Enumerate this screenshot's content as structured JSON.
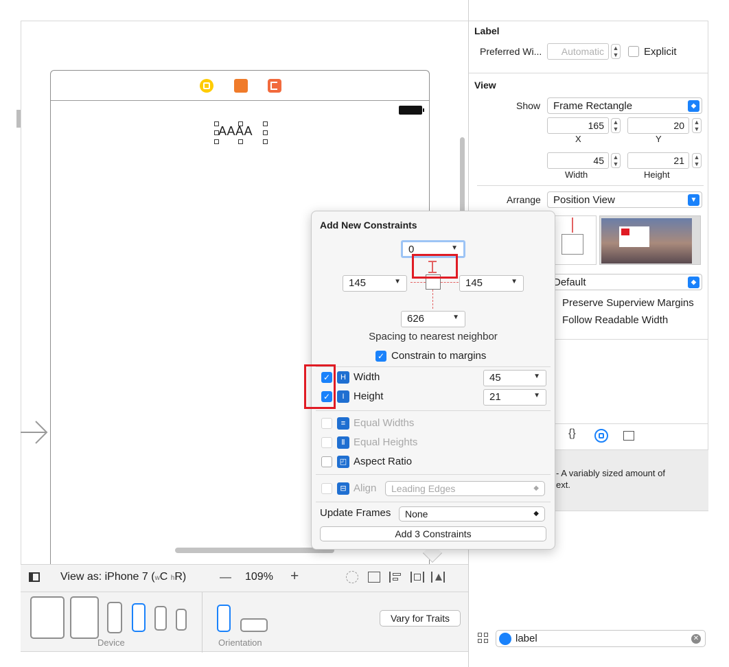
{
  "canvas": {
    "view_as_label": "View as: iPhone 7 (",
    "size_class_w": "w",
    "size_class_c": "C ",
    "size_class_h": "h",
    "size_class_r": "R)",
    "zoom_minus": "—",
    "zoom_level": "109%",
    "zoom_plus": "+",
    "label_text": "AAAA",
    "device_caption": "Device",
    "orientation_caption": "Orientation",
    "vary_button": "Vary for Traits"
  },
  "inspector": {
    "label_section": "Label",
    "preferred_width_label": "Preferred Wi...",
    "preferred_width_value": "Automatic",
    "explicit_label": "Explicit",
    "view_section": "View",
    "show_label": "Show",
    "show_value": "Frame Rectangle",
    "x_value": "165",
    "y_value": "20",
    "x_caption": "X",
    "y_caption": "Y",
    "width_value": "45",
    "height_value": "21",
    "width_caption": "Width",
    "height_caption": "Height",
    "arrange_label": "Arrange",
    "arrange_value": "Position View",
    "layout_value": "Default",
    "preserve_margins": "Preserve Superview Margins",
    "follow_readable": "Follow Readable Width",
    "library_desc_line1": "- A variably sized amount of",
    "library_desc_line2": "ext.",
    "filter_value": "label"
  },
  "popover": {
    "title": "Add New Constraints",
    "top_value": "0",
    "left_value": "145",
    "right_value": "145",
    "bottom_value": "626",
    "spacing_caption": "Spacing to nearest neighbor",
    "constrain_margins": "Constrain to margins",
    "width_label": "Width",
    "width_value": "45",
    "height_label": "Height",
    "height_value": "21",
    "equal_widths": "Equal Widths",
    "equal_heights": "Equal Heights",
    "aspect_ratio": "Aspect Ratio",
    "align_label": "Align",
    "align_value": "Leading Edges",
    "update_frames_label": "Update Frames",
    "update_frames_value": "None",
    "add_button": "Add 3 Constraints"
  },
  "colors": {
    "accent": "#1a82fb",
    "highlight": "#e01b24"
  }
}
